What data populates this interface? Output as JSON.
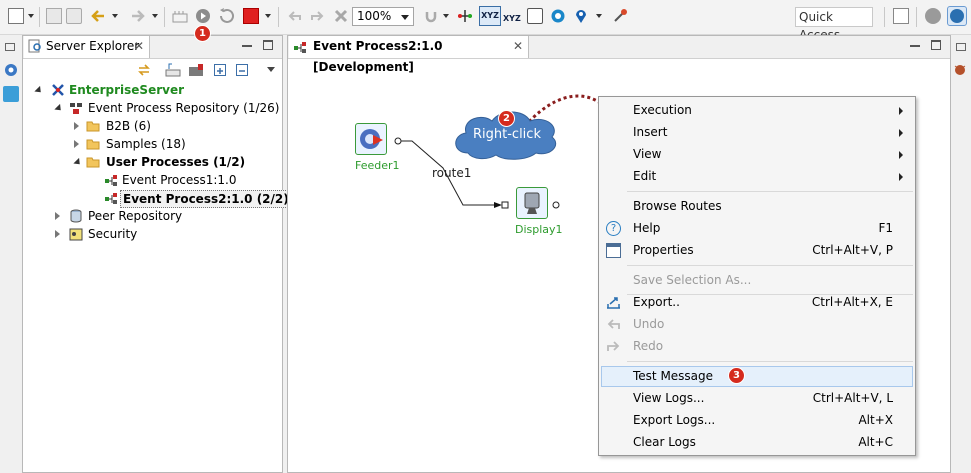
{
  "toolbar": {
    "zoom_value": "100%",
    "quick_access_label": "Quick Access",
    "xyz_label": "XYZ",
    "xyz_label_2": "XYZ"
  },
  "server_explorer": {
    "tab_title": "Server Explorer",
    "close_glyph": "✕",
    "tree": {
      "root": "EnterpriseServer",
      "repository": "Event Process Repository (1/26)",
      "b2b": "B2B (6)",
      "samples": "Samples (18)",
      "user_processes": "User Processes (1/2)",
      "ep1": "Event Process1:1.0",
      "ep2": "Event Process2:1.0 (2/2)",
      "peer": "Peer Repository",
      "security": "Security"
    }
  },
  "editor": {
    "tab_title": "Event Process2:1.0 [Development]",
    "close_glyph": "✕",
    "nodes": {
      "feeder": "Feeder1",
      "display": "Display1",
      "route": "route1"
    },
    "callout": "Right-click"
  },
  "context_menu": {
    "execution": "Execution",
    "insert": "Insert",
    "view": "View",
    "edit": "Edit",
    "browse_routes": "Browse Routes",
    "help": "Help",
    "help_shortcut": "F1",
    "properties": "Properties",
    "properties_shortcut": "Ctrl+Alt+V, P",
    "save_selection": "Save Selection As...",
    "export": "Export..",
    "export_shortcut": "Ctrl+Alt+X, E",
    "undo": "Undo",
    "redo": "Redo",
    "test_message": "Test Message",
    "view_logs": "View Logs...",
    "view_logs_shortcut": "Ctrl+Alt+V, L",
    "export_logs": "Export Logs...",
    "export_logs_shortcut": "Alt+X",
    "clear_logs": "Clear Logs",
    "clear_logs_shortcut": "Alt+C"
  },
  "badges": {
    "one": "1",
    "two": "2",
    "three": "3"
  },
  "colors": {
    "accent_red": "#d52b1e",
    "callout_blue": "#4a7fc1",
    "green_label": "#2d9b2d",
    "highlight": "#e5f0fb"
  }
}
